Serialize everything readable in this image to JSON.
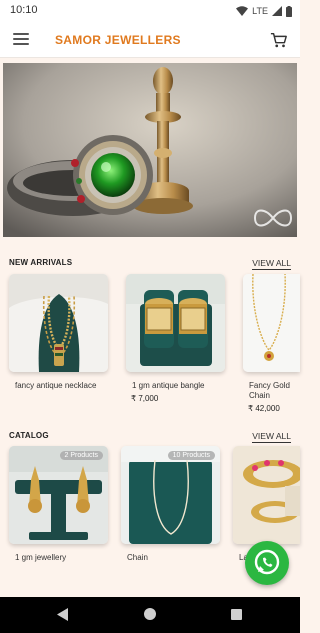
{
  "status_bar": {
    "time": "10:10",
    "network": "LTE"
  },
  "app_bar": {
    "title": "SAMOR JEWELLERS"
  },
  "banner": {
    "slide_count": 2,
    "active_slide": 1
  },
  "new_arrivals": {
    "title": "NEW ARRIVALS",
    "view_all": "VIEW ALL",
    "items": [
      {
        "name": "fancy antique necklace",
        "price": ""
      },
      {
        "name": "1 gm antique bangle",
        "price": "₹ 7,000"
      },
      {
        "name": "Fancy Gold Chain",
        "price": "₹ 42,000"
      }
    ]
  },
  "catalog": {
    "title": "CATALOG",
    "view_all": "VIEW ALL",
    "items": [
      {
        "name": "1 gm jewellery",
        "badge": "2 Products"
      },
      {
        "name": "Chain",
        "badge": "10 Products"
      },
      {
        "name": "La",
        "badge": ""
      }
    ]
  },
  "colors": {
    "accent": "#e07a1f",
    "whatsapp": "#2bb741",
    "background": "#fdf3ec"
  }
}
